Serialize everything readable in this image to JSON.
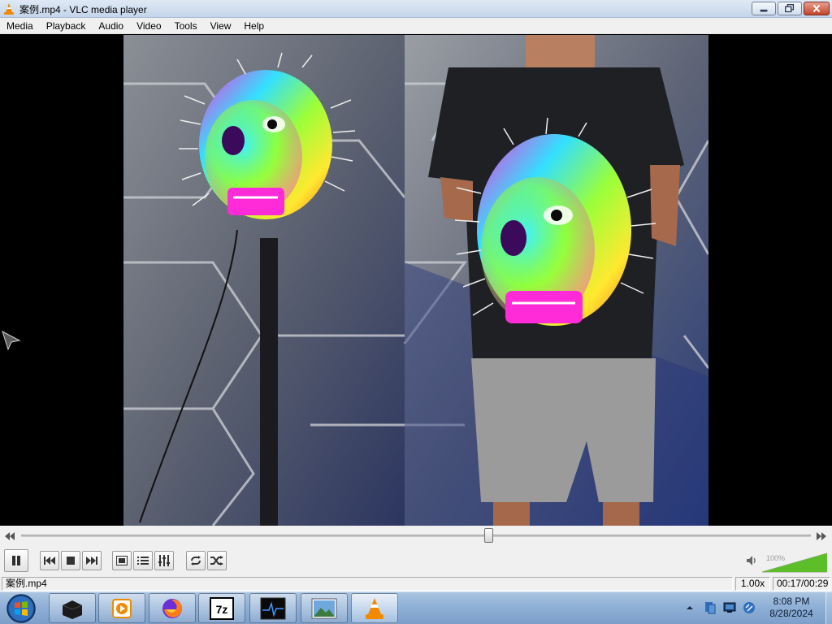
{
  "window": {
    "title": "案例.mp4 - VLC media player"
  },
  "menu": [
    "Media",
    "Playback",
    "Audio",
    "Video",
    "Tools",
    "View",
    "Help"
  ],
  "playback": {
    "progress_fraction": 0.592,
    "elapsed": "00:17",
    "total": "00:29",
    "time_display": "00:17/00:29",
    "speed": "1.00x",
    "volume_percent": 100,
    "volume_label": "100%"
  },
  "status": {
    "file_name": "案例.mp4"
  },
  "taskbar": {
    "apps": [
      {
        "name": "terminal-app",
        "icon": "black-box-icon"
      },
      {
        "name": "media-app",
        "icon": "media-player-icon"
      },
      {
        "name": "firefox",
        "icon": "firefox-icon"
      },
      {
        "name": "7zip",
        "icon": "7zip-icon"
      },
      {
        "name": "monitor-app",
        "icon": "pulse-monitor-icon"
      },
      {
        "name": "image-viewer",
        "icon": "picture-icon"
      },
      {
        "name": "vlc",
        "icon": "vlc-cone-icon",
        "active": true
      }
    ],
    "seven_zip_label": "7z",
    "clock": {
      "time": "8:08 PM",
      "date": "8/28/2024"
    }
  },
  "colors": {
    "title_bar": "#c4d5ea",
    "control_bg": "#f0f0f0",
    "vlc_orange": "#f28a00",
    "volume_green": "#5cbf2a",
    "taskbar": "#8fb0d6"
  }
}
